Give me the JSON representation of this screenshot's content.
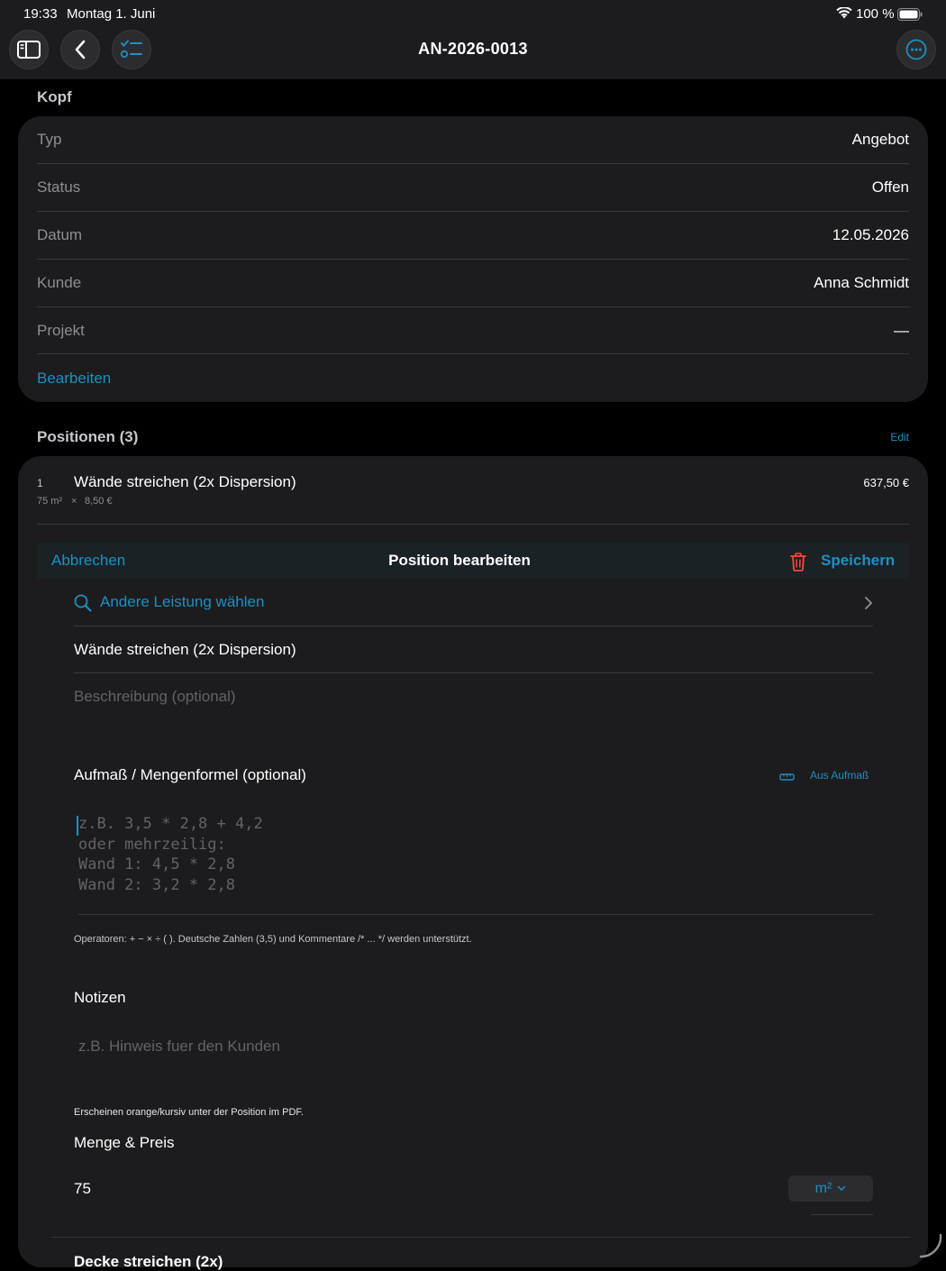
{
  "status_bar": {
    "time": "19:33",
    "date": "Montag 1. Juni",
    "battery": "100 %"
  },
  "nav": {
    "title": "AN-2026-0013"
  },
  "kopf": {
    "header": "Kopf",
    "rows": [
      {
        "label": "Typ",
        "value": "Angebot"
      },
      {
        "label": "Status",
        "value": "Offen"
      },
      {
        "label": "Datum",
        "value": "12.05.2026"
      },
      {
        "label": "Kunde",
        "value": "Anna Schmidt"
      },
      {
        "label": "Projekt",
        "value": "—"
      }
    ],
    "edit_link": "Bearbeiten"
  },
  "positionen": {
    "header": "Positionen (3)",
    "edit_label": "Edit",
    "items": [
      {
        "number": "1",
        "title": "Wände streichen (2x Dispersion)",
        "qty": "75 m²",
        "times": "×",
        "unit_price": "8,50 €",
        "total": "637,50 €"
      }
    ],
    "next_item_partial": "Decke streichen (2x)"
  },
  "editor": {
    "cancel": "Abbrechen",
    "title": "Position bearbeiten",
    "save": "Speichern",
    "choose_service": "Andere Leistung wählen",
    "name_value": "Wände streichen (2x Dispersion)",
    "description_placeholder": "Beschreibung (optional)",
    "formula_title": "Aufmaß / Mengenformel (optional)",
    "from_measurement": "Aus Aufmaß",
    "formula_placeholder": [
      "z.B. 3,5 * 2,8 + 4,2",
      "oder mehrzeilig:",
      "Wand 1: 4,5 * 2,8",
      "Wand 2: 3,2 * 2,8"
    ],
    "formula_hint": "Operatoren: + − × ÷ ( ). Deutsche Zahlen (3,5) und Kommentare /* ... */ werden unterstützt.",
    "notes_title": "Notizen",
    "notes_placeholder": "z.B. Hinweis fuer den Kunden",
    "notes_hint": "Erscheinen orange/kursiv unter der Position im PDF.",
    "qty_price_title": "Menge & Preis",
    "quantity": "75",
    "unit": "m²"
  },
  "colors": {
    "accent": "#1f8fc2",
    "danger": "#ff453a",
    "card": "#1c1c1e",
    "background": "#000000"
  }
}
